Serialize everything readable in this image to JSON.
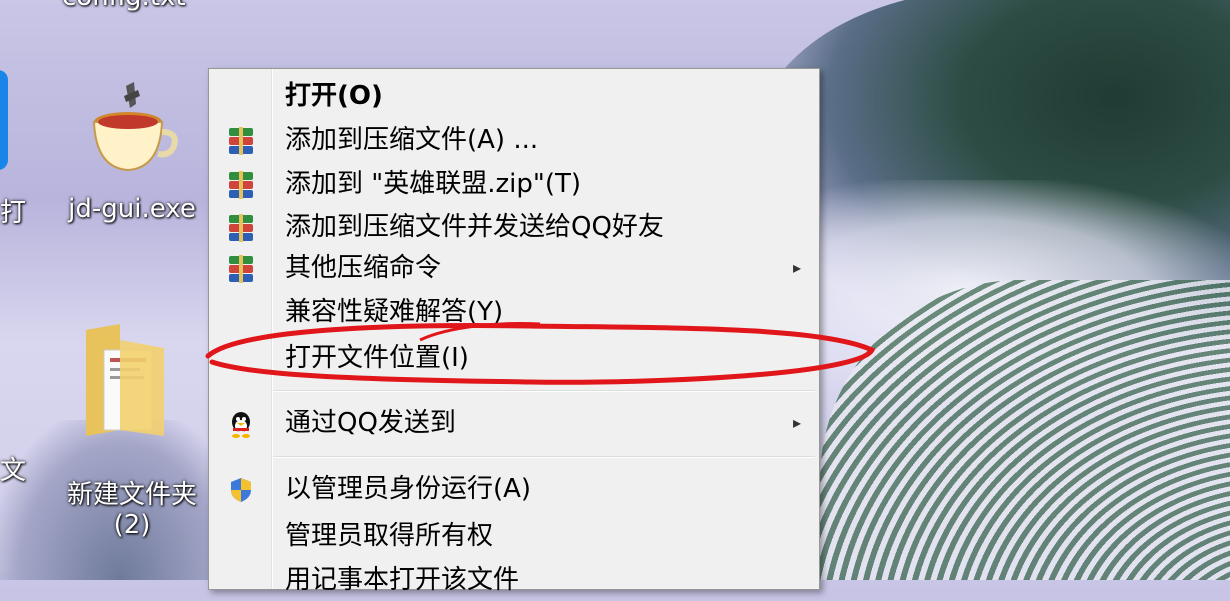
{
  "desktop": {
    "top_cut_label": "config.txt",
    "partial_left_label_1": "打",
    "partial_left_label_2": "文",
    "icons": [
      {
        "label": "jd-gui.exe"
      },
      {
        "label": "新建文件夹\n(2)"
      }
    ]
  },
  "context_menu": {
    "items": [
      {
        "label": "打开(O)",
        "bold": true
      },
      {
        "label": "添加到压缩文件(A) ...",
        "icon": "winrar-icon"
      },
      {
        "label": "添加到 \"英雄联盟.zip\"(T)",
        "icon": "winrar-icon"
      },
      {
        "label": "添加到压缩文件并发送给QQ好友",
        "icon": "winrar-icon"
      },
      {
        "label": "其他压缩命令",
        "icon": "winrar-icon",
        "submenu": true
      },
      {
        "label": "兼容性疑难解答(Y)"
      },
      {
        "label": "打开文件位置(I)",
        "highlighted_by_annotation": true
      },
      {
        "label": "通过QQ发送到",
        "icon": "qq-penguin-icon",
        "submenu": true
      },
      {
        "label": "以管理员身份运行(A)",
        "icon": "uac-shield-icon"
      },
      {
        "label": "管理员取得所有权"
      },
      {
        "label": "用记事本打开该文件"
      }
    ],
    "submenu_arrow": "▸"
  },
  "annotation": {
    "color": "#e0161a"
  }
}
